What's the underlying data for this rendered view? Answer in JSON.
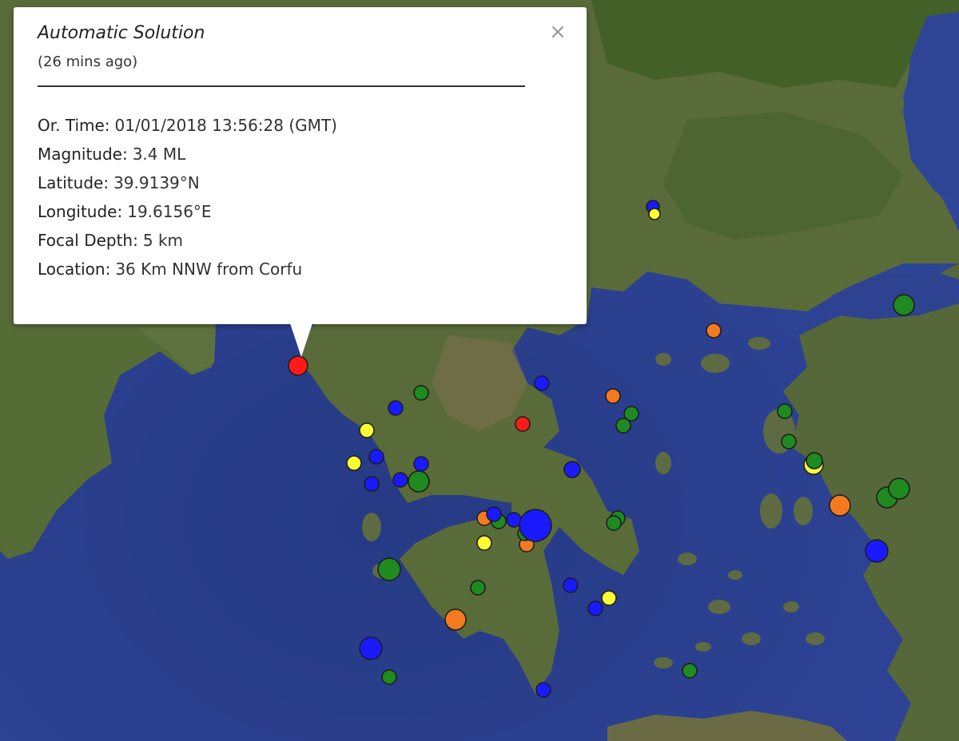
{
  "popup": {
    "title": "Automatic Solution",
    "subtitle": "(26 mins ago)",
    "close_symbol": "×",
    "fields": [
      {
        "label": "Or. Time:",
        "value": "01/01/2018  13:56:28 (GMT)"
      },
      {
        "label": "Magnitude:",
        "value": "3.4 ML"
      },
      {
        "label": "Latitude:",
        "value": "39.9139°N"
      },
      {
        "label": "Longitude:",
        "value": "19.6156°E"
      },
      {
        "label": "Focal Depth:",
        "value": "5 km"
      },
      {
        "label": "Location:",
        "value": "36 Km NNW from Corfu"
      }
    ]
  },
  "colors": {
    "sea": "#2c3f8a",
    "land_green": "#4d6b2e",
    "land_brown": "#7a6a48",
    "marker_red": "#ff1a1a",
    "marker_orange": "#f47a20",
    "marker_yellow": "#ffff33",
    "marker_green": "#1f8a1f",
    "marker_blue": "#1a1aff"
  },
  "icons": {
    "close": "close-icon"
  }
}
